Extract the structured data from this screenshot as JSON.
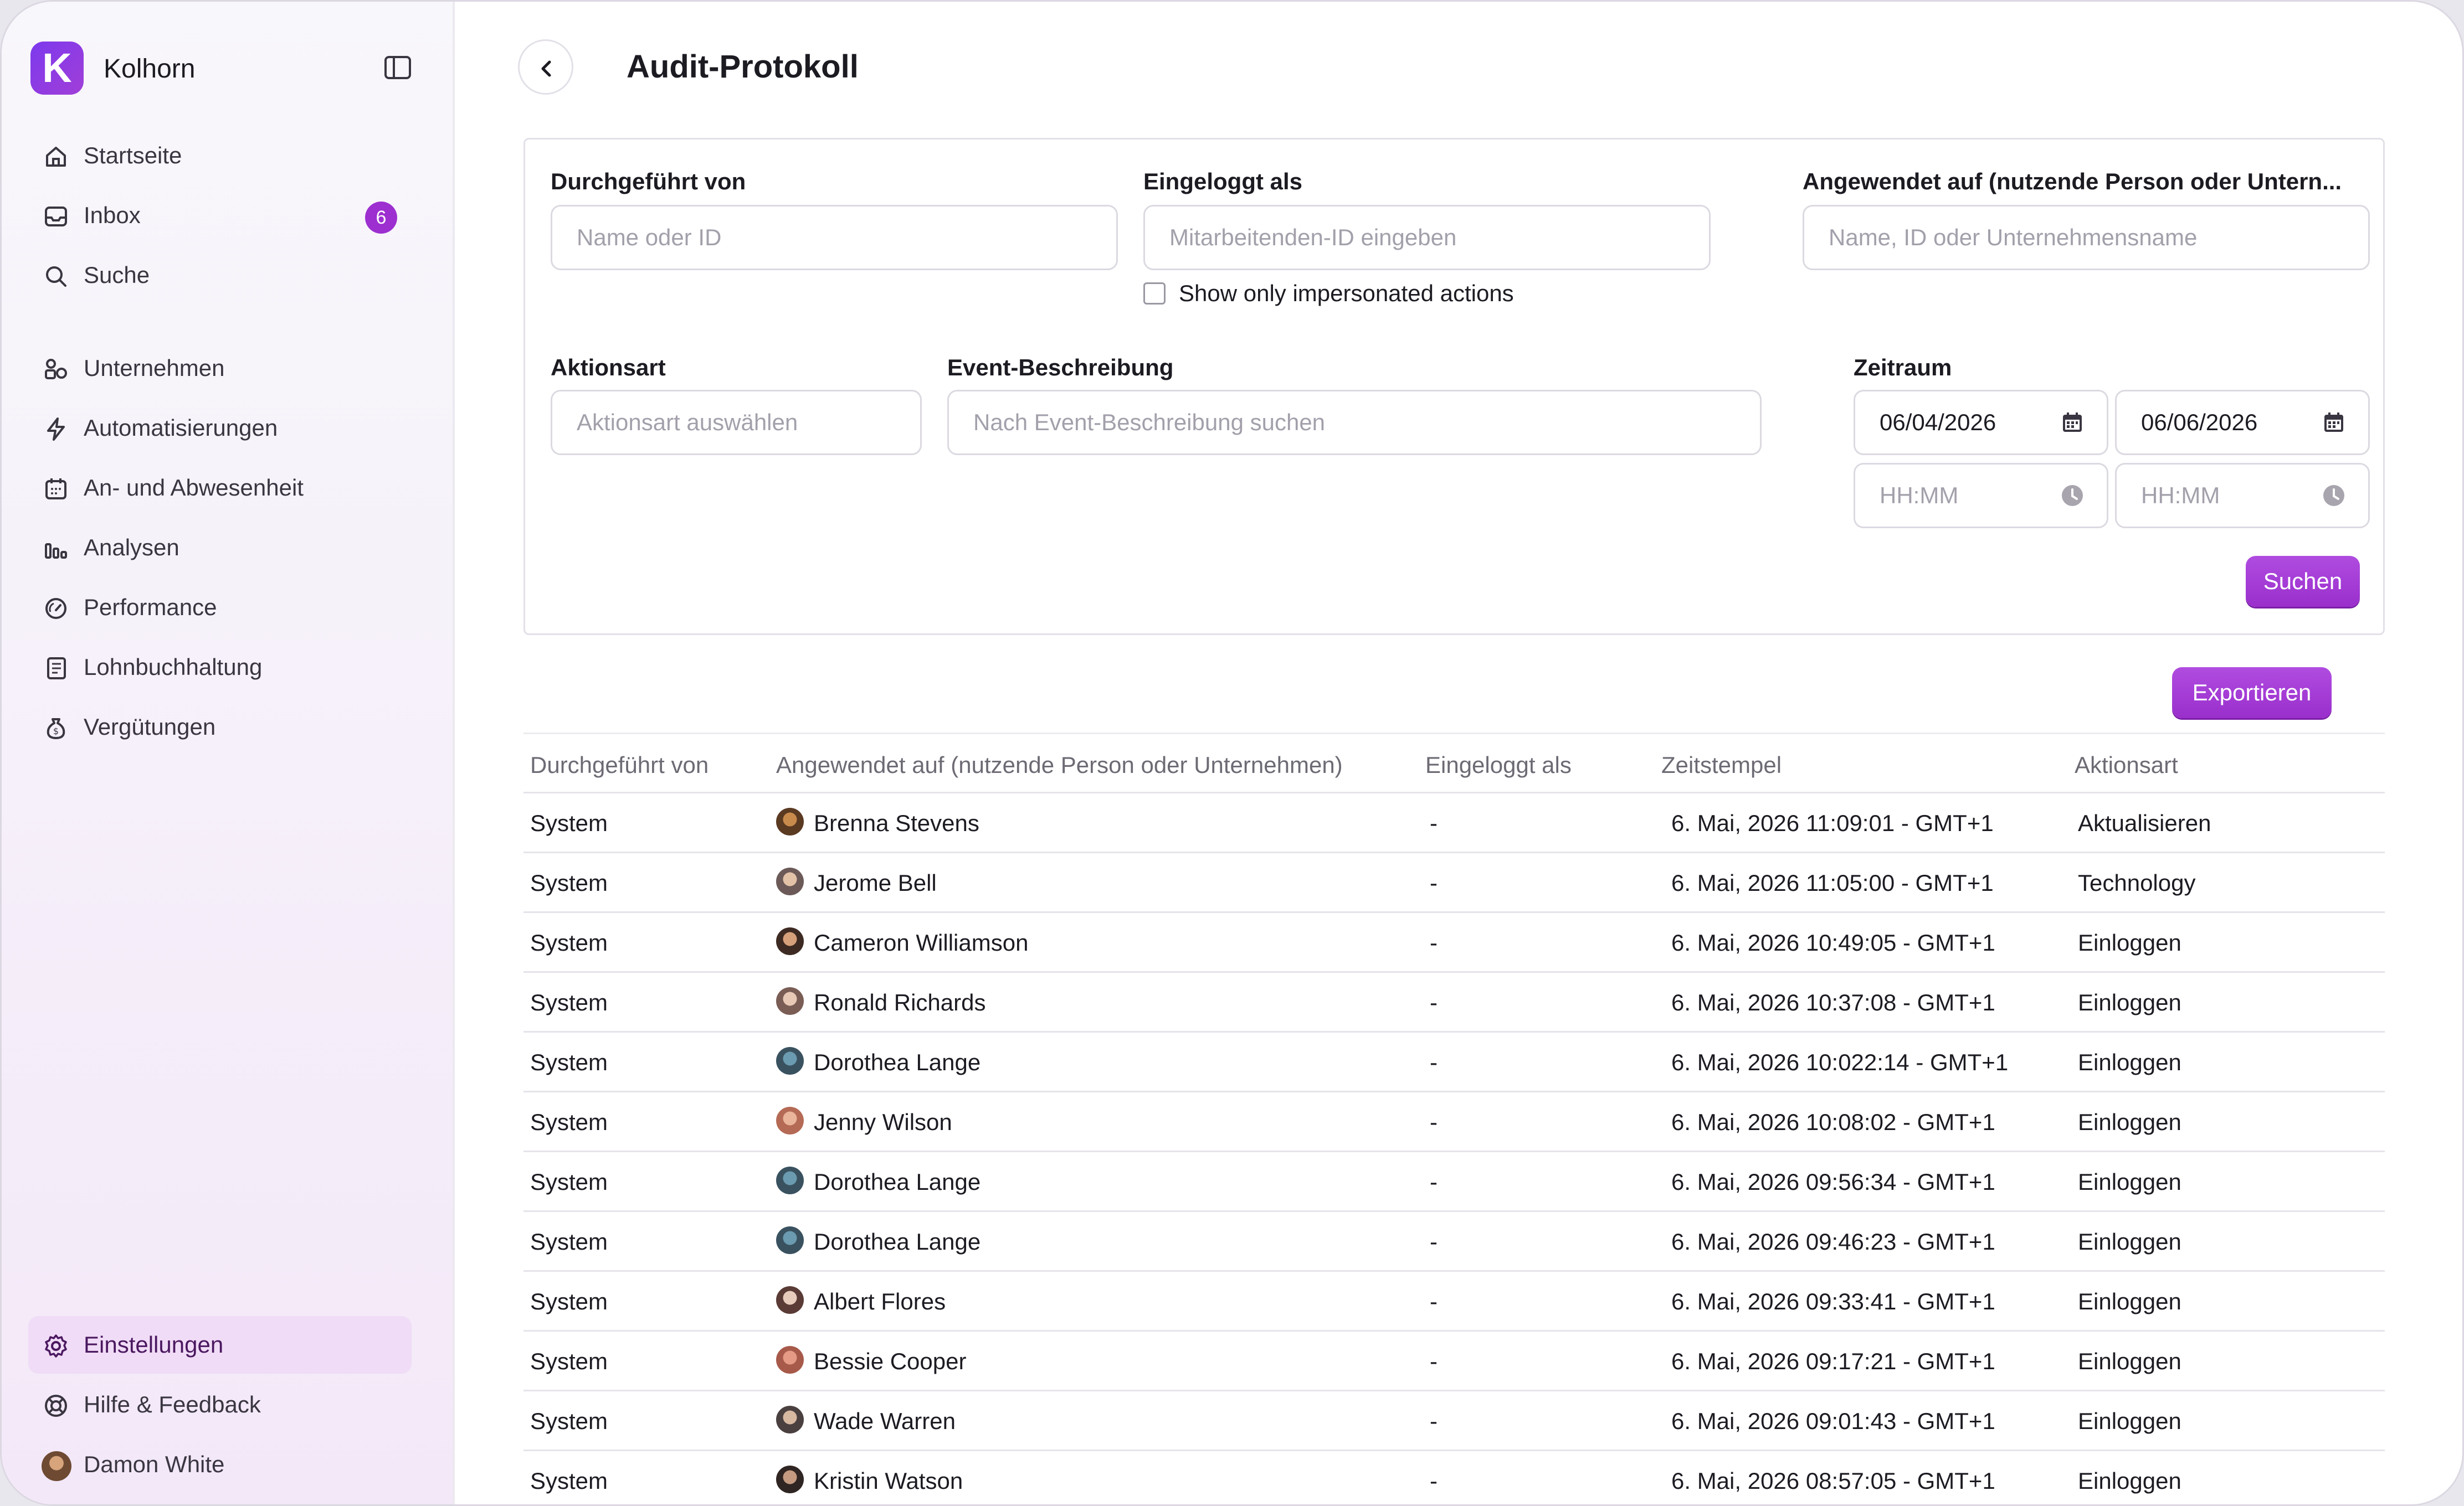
{
  "app": {
    "name": "Kolhorn",
    "logo_letter": "K"
  },
  "sidebar": {
    "items": [
      {
        "label": "Startseite",
        "icon": "home-icon"
      },
      {
        "label": "Inbox",
        "icon": "inbox-icon",
        "badge": "6"
      },
      {
        "label": "Suche",
        "icon": "search-icon"
      },
      {
        "label": "Unternehmen",
        "icon": "company-icon"
      },
      {
        "label": "Automatisierungen",
        "icon": "lightning-icon"
      },
      {
        "label": "An- und Abwesenheit",
        "icon": "calendar-icon"
      },
      {
        "label": "Analysen",
        "icon": "bar-chart-icon"
      },
      {
        "label": "Performance",
        "icon": "gauge-icon"
      },
      {
        "label": "Lohnbuchhaltung",
        "icon": "payroll-icon"
      },
      {
        "label": "Vergütungen",
        "icon": "money-bag-icon"
      }
    ],
    "bottom": {
      "settings": "Einstellungen",
      "help": "Hilfe & Feedback",
      "user": "Damon White"
    }
  },
  "header": {
    "title": "Audit-Protokoll"
  },
  "filters": {
    "performed_by": {
      "label": "Durchgeführt von",
      "placeholder": "Name oder ID"
    },
    "logged_in_as": {
      "label": "Eingeloggt als",
      "placeholder": "Mitarbeitenden-ID eingeben"
    },
    "impersonated": {
      "label": "Show only impersonated actions",
      "checked": false
    },
    "applied_to": {
      "label": "Angewendet auf (nutzende Person oder Untern...",
      "placeholder": "Name, ID oder Unternehmensname"
    },
    "action_type": {
      "label": "Aktionsart",
      "placeholder": "Aktionsart auswählen"
    },
    "event_desc": {
      "label": "Event-Beschreibung",
      "placeholder": "Nach Event-Beschreibung suchen"
    },
    "period": {
      "label": "Zeitraum",
      "from_date": "06/04/2026",
      "to_date": "06/06/2026",
      "from_time_placeholder": "HH:MM",
      "to_time_placeholder": "HH:MM"
    },
    "search_button": "Suchen"
  },
  "export_button": "Exportieren",
  "table": {
    "columns": [
      "Durchgeführt von",
      "Angewendet auf (nutzende Person oder Unternehmen)",
      "Eingeloggt als",
      "Zeitstempel",
      "Aktionsart"
    ],
    "rows": [
      {
        "by": "System",
        "applied": "Brenna Stevens",
        "logged": "-",
        "time": "6. Mai, 2026 11:09:01 - GMT+1",
        "action": "Aktualisieren"
      },
      {
        "by": "System",
        "applied": "Jerome Bell",
        "logged": "-",
        "time": "6. Mai, 2026 11:05:00 - GMT+1",
        "action": "Technology"
      },
      {
        "by": "System",
        "applied": "Cameron Williamson",
        "logged": "-",
        "time": "6. Mai, 2026 10:49:05 - GMT+1",
        "action": "Einloggen"
      },
      {
        "by": "System",
        "applied": "Ronald Richards",
        "logged": "-",
        "time": "6. Mai, 2026 10:37:08 - GMT+1",
        "action": "Einloggen"
      },
      {
        "by": "System",
        "applied": "Dorothea Lange",
        "logged": "-",
        "time": "6. Mai, 2026 10:022:14 - GMT+1",
        "action": "Einloggen"
      },
      {
        "by": "System",
        "applied": "Jenny Wilson",
        "logged": "-",
        "time": "6. Mai, 2026 10:08:02 - GMT+1",
        "action": "Einloggen"
      },
      {
        "by": "System",
        "applied": "Dorothea Lange",
        "logged": "-",
        "time": "6. Mai, 2026 09:56:34 - GMT+1",
        "action": "Einloggen"
      },
      {
        "by": "System",
        "applied": "Dorothea Lange",
        "logged": "-",
        "time": "6. Mai, 2026 09:46:23 - GMT+1",
        "action": "Einloggen"
      },
      {
        "by": "System",
        "applied": "Albert Flores",
        "logged": "-",
        "time": "6. Mai, 2026 09:33:41 - GMT+1",
        "action": "Einloggen"
      },
      {
        "by": "System",
        "applied": "Bessie Cooper",
        "logged": "-",
        "time": "6. Mai, 2026 09:17:21 - GMT+1",
        "action": "Einloggen"
      },
      {
        "by": "System",
        "applied": "Wade Warren",
        "logged": "-",
        "time": "6. Mai, 2026 09:01:43 - GMT+1",
        "action": "Einloggen"
      },
      {
        "by": "System",
        "applied": "Kristin Watson",
        "logged": "-",
        "time": "6. Mai, 2026 08:57:05 - GMT+1",
        "action": "Einloggen"
      }
    ]
  },
  "colors": {
    "accent": "#9d2fd0",
    "active_bg": "#f0dcf6"
  }
}
